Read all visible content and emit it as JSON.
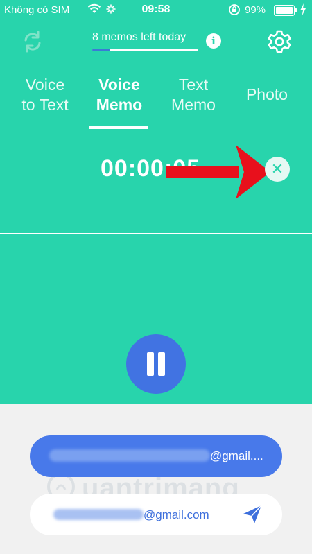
{
  "status_bar": {
    "carrier": "Không có SIM",
    "time": "09:58",
    "battery": "99%",
    "battery_level": 0.99
  },
  "header": {
    "memos_left": "8 memos left today",
    "memos_progress": 0.17,
    "info_label": "i"
  },
  "tabs": [
    {
      "line1": "Voice",
      "line2": "to Text"
    },
    {
      "line1": "Voice",
      "line2": "Memo"
    },
    {
      "line1": "Text",
      "line2": "Memo"
    },
    {
      "line1": "Photo",
      "line2": ""
    }
  ],
  "active_tab": 1,
  "recording": {
    "timer": "00:00:05",
    "close_symbol": "✕"
  },
  "emails": [
    {
      "suffix": "@gmail...."
    },
    {
      "suffix": "@gmail.com"
    }
  ],
  "watermark": "uantrimang",
  "colors": {
    "accent": "#28d4ac",
    "button_blue": "#4173e2",
    "arrow_red": "#e8101c"
  },
  "icons": [
    "refresh-icon",
    "info-icon",
    "gear-icon",
    "close-icon",
    "pause-icon",
    "send-icon",
    "wifi-icon",
    "battery-icon"
  ]
}
